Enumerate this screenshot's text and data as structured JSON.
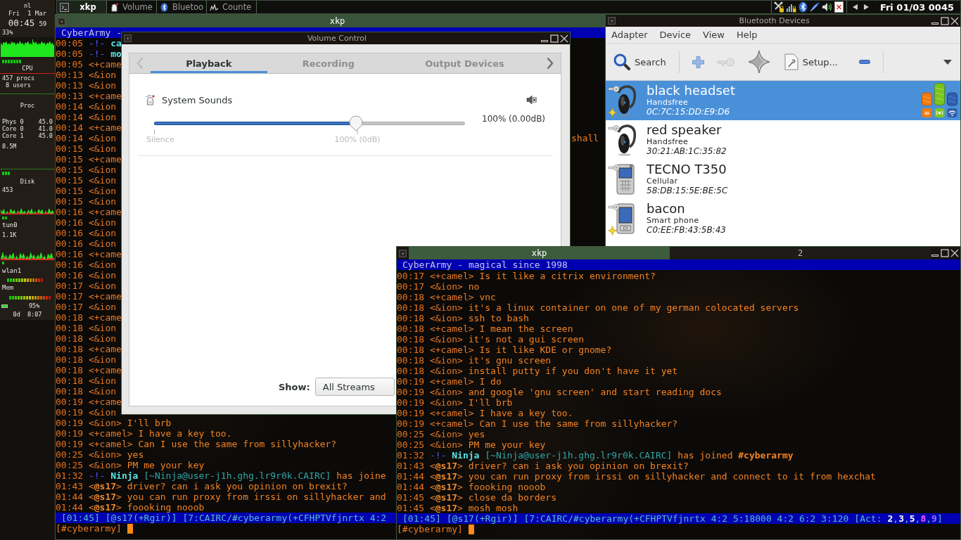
{
  "taskbar": {
    "tasks": [
      {
        "kind": "terminal",
        "label": "xkp",
        "selected": true
      },
      {
        "kind": "volume",
        "label": "Volume",
        "selected": false
      },
      {
        "kind": "bluetooth",
        "label": "Bluetoo",
        "selected": false
      },
      {
        "kind": "counter",
        "label": "Counte",
        "selected": false
      }
    ],
    "clock": "Fri 01/03 0045"
  },
  "system_monitor": {
    "hostname": "nl",
    "date": "Fri  1 Mar",
    "clock": "00:45",
    "seconds": "59",
    "cpu": {
      "reading": "33%",
      "label": "CPU"
    },
    "processes": "457 procs",
    "users": "8 users",
    "proc": {
      "label": "Proc",
      "sensors": [
        {
          "name": "Phys 0",
          "value": "45.0"
        },
        {
          "name": "Core 0",
          "value": "41.0"
        },
        {
          "name": "Core 1",
          "value": "45.0"
        }
      ],
      "reading": "8.5M"
    },
    "disk": {
      "label": "Disk",
      "reading": "453"
    },
    "network": {
      "label": "tun0",
      "reading": "1.1K"
    },
    "wireless": {
      "label": "wlan1"
    },
    "memory": {
      "label": "Mem"
    },
    "battery": {
      "reading": "95%"
    },
    "uptime": "0d  8:07"
  },
  "chat_window_back": {
    "title": "xkp",
    "topic": "CyberArmy -",
    "lines": [
      {
        "kind": "event",
        "time": "00:05",
        "marker": "-!-",
        "nick": "ca"
      },
      {
        "kind": "event",
        "time": "00:05",
        "marker": "-!-",
        "nick": "mo"
      },
      {
        "kind": "message",
        "time": "00:05",
        "nick": "<+came"
      },
      {
        "kind": "message",
        "time": "00:13",
        "nick": "<&ion"
      },
      {
        "kind": "message",
        "time": "00:13",
        "nick": "<&ion"
      },
      {
        "kind": "message",
        "time": "00:13",
        "nick": "<+came"
      },
      {
        "kind": "message",
        "time": "00:14",
        "nick": "<&ion"
      },
      {
        "kind": "message",
        "time": "00:14",
        "nick": "<&ion"
      },
      {
        "kind": "message",
        "time": "00:14",
        "nick": "<+came"
      },
      {
        "kind": "message",
        "time": "00:14",
        "nick": "<&ion",
        "tail": "shall"
      },
      {
        "kind": "message",
        "time": "00:15",
        "nick": "<&ion"
      },
      {
        "kind": "message",
        "time": "00:15",
        "nick": "<+came"
      },
      {
        "kind": "message",
        "time": "00:15",
        "nick": "<&ion"
      },
      {
        "kind": "message",
        "time": "00:15",
        "nick": "<&ion"
      },
      {
        "kind": "message",
        "time": "00:15",
        "nick": "<&ion"
      },
      {
        "kind": "message",
        "time": "00:15",
        "nick": "<&ion"
      },
      {
        "kind": "message",
        "time": "00:16",
        "nick": "<+came"
      },
      {
        "kind": "message",
        "time": "00:16",
        "nick": "<&ion"
      },
      {
        "kind": "message",
        "time": "00:16",
        "nick": "<&ion"
      },
      {
        "kind": "message",
        "time": "00:16",
        "nick": "<&ion"
      },
      {
        "kind": "message",
        "time": "00:16",
        "nick": "<+came"
      },
      {
        "kind": "message",
        "time": "00:16",
        "nick": "<&ion"
      },
      {
        "kind": "message",
        "time": "00:16",
        "nick": "<&ion"
      },
      {
        "kind": "message",
        "time": "00:17",
        "nick": "<&ion"
      },
      {
        "kind": "message",
        "time": "00:17",
        "nick": "<+came"
      },
      {
        "kind": "message",
        "time": "00:17",
        "nick": "<&ion"
      },
      {
        "kind": "message",
        "time": "00:18",
        "nick": "<+came"
      },
      {
        "kind": "message",
        "time": "00:18",
        "nick": "<&ion"
      },
      {
        "kind": "message",
        "time": "00:18",
        "nick": "<&ion"
      },
      {
        "kind": "message",
        "time": "00:18",
        "nick": "<+came"
      },
      {
        "kind": "message",
        "time": "00:18",
        "nick": "<&ion"
      },
      {
        "kind": "message",
        "time": "00:18",
        "nick": "<+came"
      },
      {
        "kind": "message",
        "time": "00:18",
        "nick": "<&ion"
      },
      {
        "kind": "message",
        "time": "00:18",
        "nick": "<&ion"
      },
      {
        "kind": "message",
        "time": "00:19",
        "nick": "<+came"
      },
      {
        "kind": "message",
        "time": "00:19",
        "nick": "<&ion"
      },
      {
        "kind": "message",
        "time": "00:19",
        "nick": "<&ion>",
        "text": "I'll brb"
      },
      {
        "kind": "message",
        "time": "00:19",
        "nick": "<+camel>",
        "text": "I have a key too."
      },
      {
        "kind": "message",
        "time": "00:19",
        "nick": "<+camel>",
        "text": "Can I use the same from sillyhacker?"
      },
      {
        "kind": "message",
        "time": "00:25",
        "nick": "<&ion>",
        "text": "yes"
      },
      {
        "kind": "message",
        "time": "00:25",
        "nick": "<&ion>",
        "text": "PM me your key"
      },
      {
        "kind": "event",
        "time": "01:32",
        "marker": "-!-",
        "nick": "Ninja",
        "host": "[~Ninja@user-j1h.ghg.lr9r0k.CAIRC]",
        "text": "has joine"
      },
      {
        "kind": "message",
        "time": "01:43",
        "nick": "<**@s17**>",
        "text": "driver? can i ask you opinion on brexit?"
      },
      {
        "kind": "message",
        "time": "01:44",
        "nick": "<**@s17**>",
        "text": "you can run proxy from irssi on sillyhacker and"
      },
      {
        "kind": "message",
        "time": "01:44",
        "nick": "<**@s17**>",
        "text": "foooking nooob"
      }
    ],
    "status": {
      "segments": [
        "[01:45]",
        "[@s17(+Rgir)]",
        "[7:CAIRC/#cyberarmy(+CFHPTVfjnrtx 4:2"
      ]
    },
    "prompt": "[#cyberarmy]"
  },
  "volume_control": {
    "title": "Volume Control",
    "tab_arrows": [
      {
        "kind": "back",
        "disabled": true
      },
      {
        "kind": "forward",
        "disabled": false
      }
    ],
    "tabs": [
      {
        "label": "Playback",
        "selected": true
      },
      {
        "label": "Recording",
        "selected": false
      },
      {
        "label": "Output Devices",
        "selected": false
      }
    ],
    "streams": [
      {
        "name": "System Sounds",
        "level": 0.65,
        "reading": "100% (0.00dB)",
        "marks": [
          {
            "kind": "min",
            "label": "Silence"
          },
          {
            "kind": "norm",
            "label": "100% (0dB)"
          }
        ]
      }
    ],
    "filter": {
      "label": "Show:",
      "value": "All Streams"
    }
  },
  "bluetooth_devices": {
    "title": "Bluetooth Devices",
    "menu": [
      "Adapter",
      "Device",
      "View",
      "Help"
    ],
    "toolbar": [
      {
        "kind": "search",
        "label": "Search",
        "disabled": false
      },
      {
        "kind": "separator"
      },
      {
        "kind": "add",
        "disabled": false
      },
      {
        "kind": "key",
        "disabled": true
      },
      {
        "kind": "star",
        "disabled": false
      },
      {
        "kind": "setup",
        "label": "Setup...",
        "disabled": false
      },
      {
        "kind": "remove",
        "disabled": false
      },
      {
        "kind": "separator"
      },
      {
        "kind": "more",
        "disabled": false
      }
    ],
    "devices": [
      {
        "kind": "headset",
        "name": "black headset",
        "type": "Handsfree",
        "address": "0C:7C:15:DD:E9:D6",
        "selected": true,
        "paired": true,
        "trusted": true,
        "connected": true
      },
      {
        "kind": "headset",
        "name": "red speaker",
        "type": "Handsfree",
        "address": "30:21:AB:1C:35:82",
        "selected": false,
        "paired": true,
        "trusted": false,
        "connected": false
      },
      {
        "kind": "phone",
        "name": "TECNO T350",
        "type": "Cellular",
        "address": "58:DB:15:5E:BE:5C",
        "selected": false,
        "paired": true,
        "trusted": false,
        "connected": false
      },
      {
        "kind": "smartphone",
        "name": "bacon",
        "type": "Smart phone",
        "address": "C0:EE:FB:43:5B:43",
        "selected": false,
        "paired": true,
        "trusted": true,
        "connected": false
      }
    ]
  },
  "chat_window_front": {
    "tabs": [
      {
        "label": "xkp",
        "selected": true
      },
      {
        "label": "2",
        "selected": false
      }
    ],
    "topic": "CyberArmy - magical since 1998",
    "lines": [
      {
        "kind": "message",
        "time": "00:17",
        "nick": "<+camel>",
        "text": "Is it like a citrix environment?"
      },
      {
        "kind": "message",
        "time": "00:17",
        "nick": "<&ion>",
        "text": "no"
      },
      {
        "kind": "message",
        "time": "00:18",
        "nick": "<+camel>",
        "text": "vnc"
      },
      {
        "kind": "message",
        "time": "00:18",
        "nick": "<&ion>",
        "text": "it's a linux container on one of my german colocated servers"
      },
      {
        "kind": "message",
        "time": "00:18",
        "nick": "<&ion>",
        "text": "ssh to bash"
      },
      {
        "kind": "message",
        "time": "00:18",
        "nick": "<+camel>",
        "text": "I mean the screen"
      },
      {
        "kind": "message",
        "time": "00:18",
        "nick": "<&ion>",
        "text": "it's not a gui screen"
      },
      {
        "kind": "message",
        "time": "00:18",
        "nick": "<+camel>",
        "text": "Is it like KDE or gnome?"
      },
      {
        "kind": "message",
        "time": "00:18",
        "nick": "<&ion>",
        "text": "it's gnu screen"
      },
      {
        "kind": "message",
        "time": "00:18",
        "nick": "<&ion>",
        "text": "install putty if you don't have it yet"
      },
      {
        "kind": "message",
        "time": "00:19",
        "nick": "<+camel>",
        "text": "I do"
      },
      {
        "kind": "message",
        "time": "00:19",
        "nick": "<&ion>",
        "text": "and google 'gnu screen' and start reading docs"
      },
      {
        "kind": "message",
        "time": "00:19",
        "nick": "<&ion>",
        "text": "I'll brb"
      },
      {
        "kind": "message",
        "time": "00:19",
        "nick": "<+camel>",
        "text": "I have a key too."
      },
      {
        "kind": "message",
        "time": "00:19",
        "nick": "<+camel>",
        "text": "Can I use the same from sillyhacker?"
      },
      {
        "kind": "message",
        "time": "00:25",
        "nick": "<&ion>",
        "text": "yes"
      },
      {
        "kind": "message",
        "time": "00:25",
        "nick": "<&ion>",
        "text": "PM me your key"
      },
      {
        "kind": "event",
        "time": "01:32",
        "marker": "-!-",
        "nick": "Ninja",
        "host": "[~Ninja@user-j1h.ghg.lr9r0k.CAIRC]",
        "text": "has joined",
        "channel": "#cyberarmy"
      },
      {
        "kind": "message",
        "time": "01:43",
        "nick": "<**@s17**>",
        "text": "driver? can i ask you opinion on brexit?"
      },
      {
        "kind": "message",
        "time": "01:44",
        "nick": "<**@s17**>",
        "text": "you can run proxy from irssi on sillyhacker and connect to it from hexchat"
      },
      {
        "kind": "message",
        "time": "01:44",
        "nick": "<**@s17**>",
        "text": "foooking nooob"
      },
      {
        "kind": "message",
        "time": "01:45",
        "nick": "<**@s17**>",
        "text": "close da borders"
      },
      {
        "kind": "message",
        "time": "01:45",
        "nick": "<**@s17**>",
        "text": "mosh mosh"
      }
    ],
    "status": {
      "segments": [
        "[01:45]",
        "[@s17(+Rgir)]",
        "[7:CAIRC/#cyberarmy(+CFHPTVfjnrtx 4:2 5:18000 4:2 6:2 3:120"
      ],
      "activity": {
        "label": "[Act:",
        "items": [
          {
            "label": "2",
            "separator": ",",
            "kind": "message"
          },
          {
            "label": "3",
            "separator": ",",
            "kind": "message"
          },
          {
            "label": "5",
            "separator": ",",
            "kind": "message"
          },
          {
            "label": "8",
            "separator": ",",
            "kind": "highlight"
          },
          {
            "label": "9",
            "kind": "query"
          }
        ],
        "end": "]"
      }
    },
    "prompt": "[#cyberarmy]"
  }
}
